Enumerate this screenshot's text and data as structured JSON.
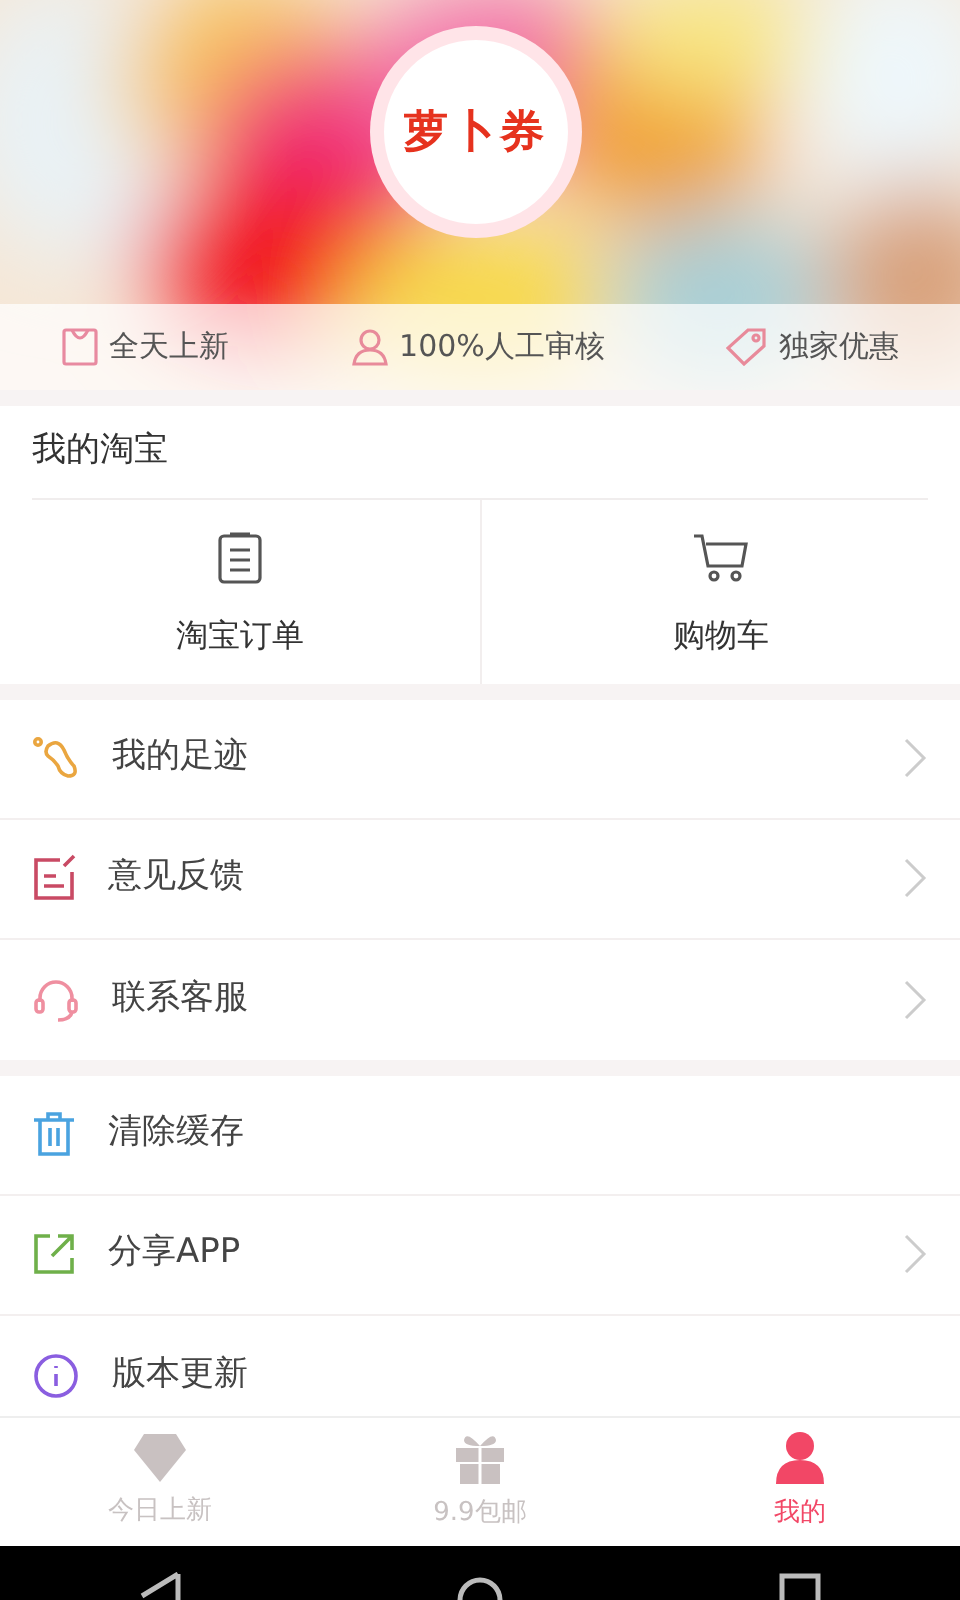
{
  "hero": {
    "badge": "萝卜券",
    "features": [
      {
        "kind": "bag",
        "label": "全天上新"
      },
      {
        "kind": "person",
        "label": "100%人工审核"
      },
      {
        "kind": "tag",
        "label": "独家优惠"
      }
    ]
  },
  "my_taobao": {
    "title": "我的淘宝",
    "shortcuts": [
      {
        "kind": "orders",
        "label": "淘宝订单"
      },
      {
        "kind": "cart",
        "label": "购物车"
      }
    ]
  },
  "menu_groups": [
    {
      "items": [
        {
          "kind": "footprint",
          "label": "我的足迹",
          "chevron": true
        },
        {
          "kind": "feedback",
          "label": "意见反馈",
          "chevron": true
        },
        {
          "kind": "service",
          "label": "联系客服",
          "chevron": true
        }
      ]
    },
    {
      "items": [
        {
          "kind": "trash",
          "label": "清除缓存",
          "chevron": false
        },
        {
          "kind": "share",
          "label": "分享APP",
          "chevron": true
        },
        {
          "kind": "update",
          "label": "版本更新",
          "chevron": false
        }
      ]
    }
  ],
  "tab_bar": [
    {
      "kind": "diamond",
      "label": "今日上新",
      "selected": false
    },
    {
      "kind": "gift",
      "label": "9.9包邮",
      "selected": false
    },
    {
      "kind": "person",
      "label": "我的",
      "selected": true
    }
  ]
}
